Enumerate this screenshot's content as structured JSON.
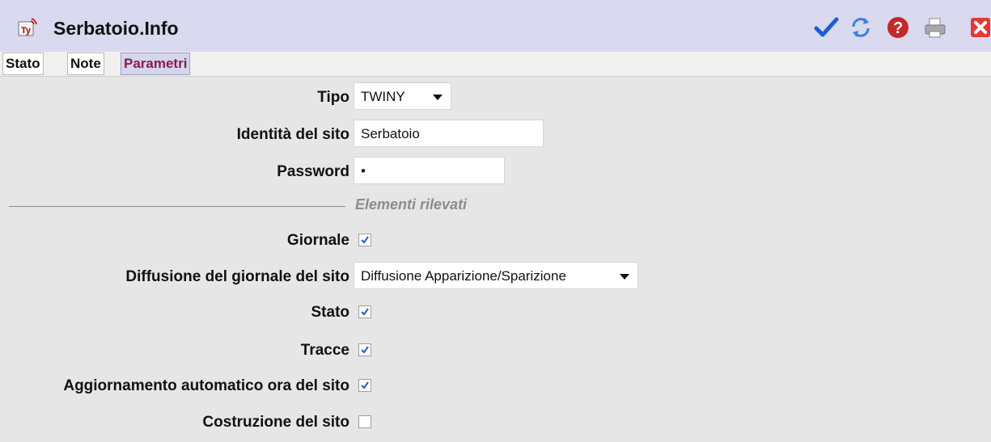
{
  "window": {
    "title": "Serbatoio.Info"
  },
  "toolbar": {
    "icons": [
      "check-icon",
      "refresh-icon",
      "help-icon",
      "print-icon",
      "close-icon"
    ]
  },
  "tabs": [
    {
      "label": "Stato",
      "active": false
    },
    {
      "label": "Note",
      "active": false
    },
    {
      "label": "Parametri",
      "active": true
    }
  ],
  "form": {
    "tipo": {
      "label": "Tipo",
      "value": "TWINY"
    },
    "identita": {
      "label": "Identità del sito",
      "value": "Serbatoio"
    },
    "password": {
      "label": "Password",
      "value": "•"
    },
    "section": {
      "title": "Elementi rilevati"
    },
    "giornale": {
      "label": "Giornale",
      "checked": true
    },
    "diffusione": {
      "label": "Diffusione del giornale del sito",
      "value": "Diffusione Apparizione/Sparizione"
    },
    "stato": {
      "label": "Stato",
      "checked": true
    },
    "tracce": {
      "label": "Tracce",
      "checked": true
    },
    "aggiornamento": {
      "label": "Aggiornamento automatico ora del sito",
      "checked": true
    },
    "costruzione": {
      "label": "Costruzione del sito",
      "checked": false
    }
  },
  "colors": {
    "titlebar": "#d9d9f0",
    "active_tab_text": "#8b1a4a",
    "check": "#1e5bd6",
    "help": "#c62828",
    "close": "#e53935"
  }
}
